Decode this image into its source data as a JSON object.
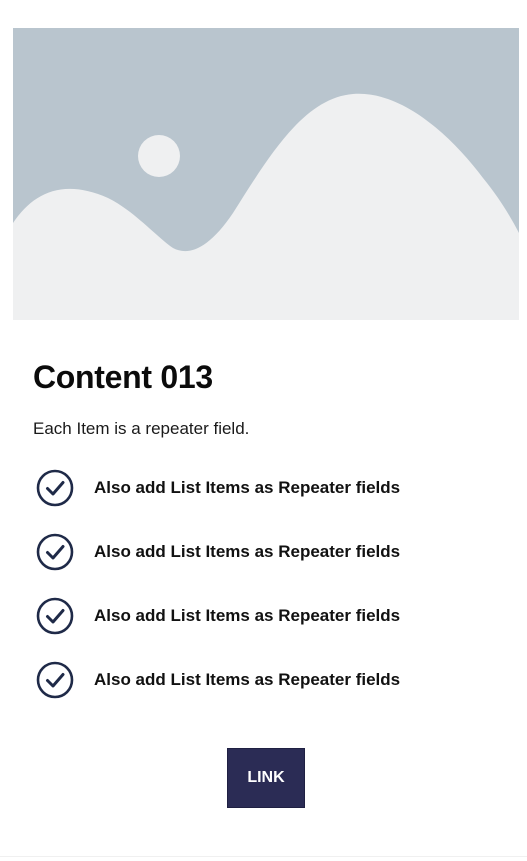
{
  "card": {
    "image": {
      "icon": "image-placeholder-icon",
      "colors": {
        "sky": "#b9c5ce",
        "land": "#eff0f1",
        "sun": "#eff0f1"
      }
    },
    "title": "Content 013",
    "subtitle": "Each Item is a repeater field.",
    "list": {
      "icon": "check-circle-icon",
      "icon_color": "#1f2a48",
      "items": [
        {
          "label": "Also add List Items as Repeater fields"
        },
        {
          "label": "Also add List Items as Repeater fields"
        },
        {
          "label": "Also add List Items as Repeater fields"
        },
        {
          "label": "Also add List Items as Repeater fields"
        }
      ]
    },
    "button": {
      "label": "LINK",
      "color": "#2b2c55"
    }
  }
}
